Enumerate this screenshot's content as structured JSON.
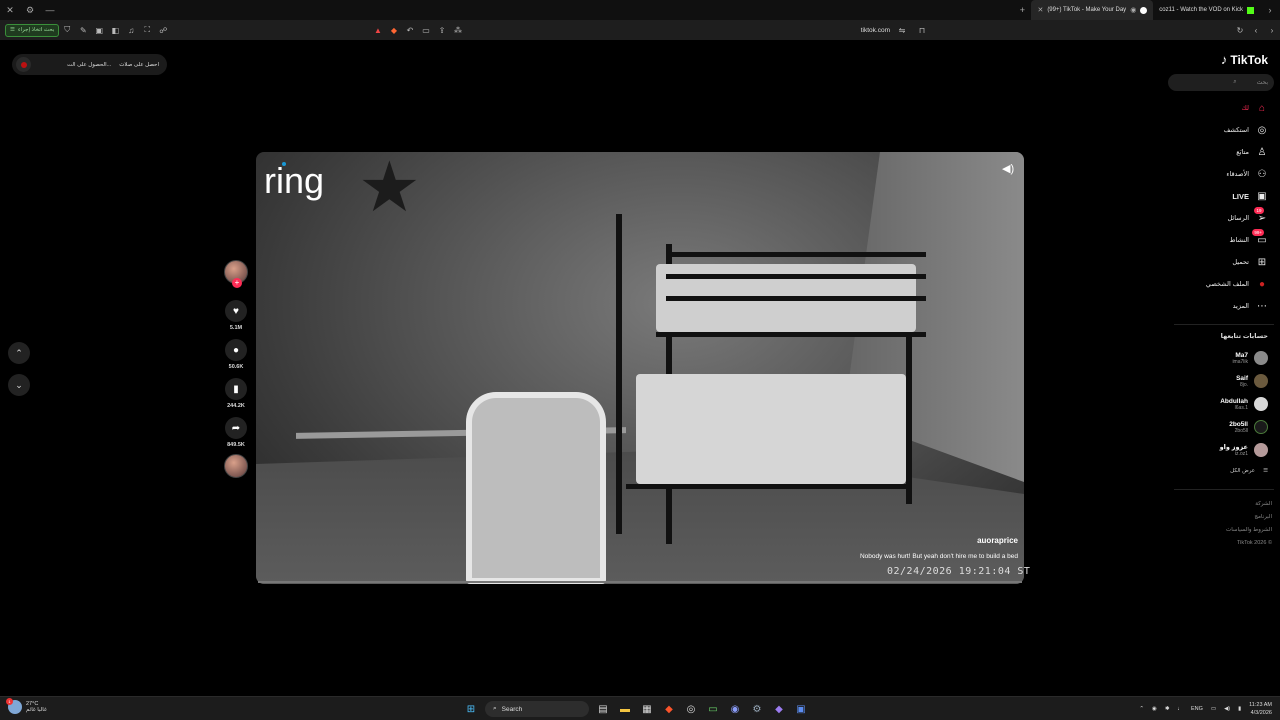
{
  "browser": {
    "tabs": [
      {
        "label": "(99+) TikTok - Make Your Day",
        "active": true
      },
      {
        "label": "coz11 - Watch the VOD on Kick",
        "active": false
      }
    ],
    "domain": "tiktok.com",
    "sidebar_button_label": "بحث اتخاذ إجراء"
  },
  "captions_pill": {
    "item1": "احصل على صلات",
    "item2": "الحصول على الت..."
  },
  "video": {
    "watermark": "ring",
    "author": "auoraprice",
    "caption": "Nobody was hurt! But yeah don't hire me to build a bed",
    "timestamp": "02/24/2026 19:21:04 ST"
  },
  "actions": {
    "likes": "5.1M",
    "comments": "50.6K",
    "saves": "244.2K",
    "shares": "849.5K"
  },
  "sidebar": {
    "logo": "TikTok",
    "search_placeholder": "بحث",
    "nav": [
      {
        "label": "لك",
        "icon": "home-icon",
        "active": true
      },
      {
        "label": "استكشف",
        "icon": "compass-icon"
      },
      {
        "label": "متابَع",
        "icon": "user-follow-icon"
      },
      {
        "label": "الأصدقاء",
        "icon": "friends-icon"
      },
      {
        "label": "LIVE",
        "icon": "live-icon"
      },
      {
        "label": "الرسائل",
        "icon": "messages-icon",
        "badge": "19"
      },
      {
        "label": "النشاط",
        "icon": "activity-icon",
        "badge": "99+"
      },
      {
        "label": "تحميل",
        "icon": "upload-icon"
      },
      {
        "label": "الملف الشخصي",
        "icon": "profile-icon"
      },
      {
        "label": "المزيد",
        "icon": "more-icon"
      }
    ],
    "following_title": "حسابات تتابعها",
    "following": [
      {
        "name": "Ma7",
        "handle": "ima7lik"
      },
      {
        "name": "Saif",
        "handle": "8jo."
      },
      {
        "name": "Abdullah",
        "handle": "l6as.1"
      },
      {
        "name": "2bo5ll",
        "handle": "2bo5ll"
      },
      {
        "name": "عزوز واو",
        "handle": "iz.oz1"
      }
    ],
    "see_all": "عرض الكل",
    "footer": [
      "الشركة",
      "البرنامج",
      "الشروط والسياسات",
      "TikTok 2026 ©"
    ]
  },
  "taskbar": {
    "weather_temp": "27°C",
    "weather_desc": "غالبا غائم",
    "search_label": "Search",
    "lang": "ENG",
    "time": "11:23 AM",
    "date": "4/3/2026"
  },
  "colors": {
    "accent": "#fe2c55",
    "background": "#000000",
    "kick": "#53fc18"
  }
}
